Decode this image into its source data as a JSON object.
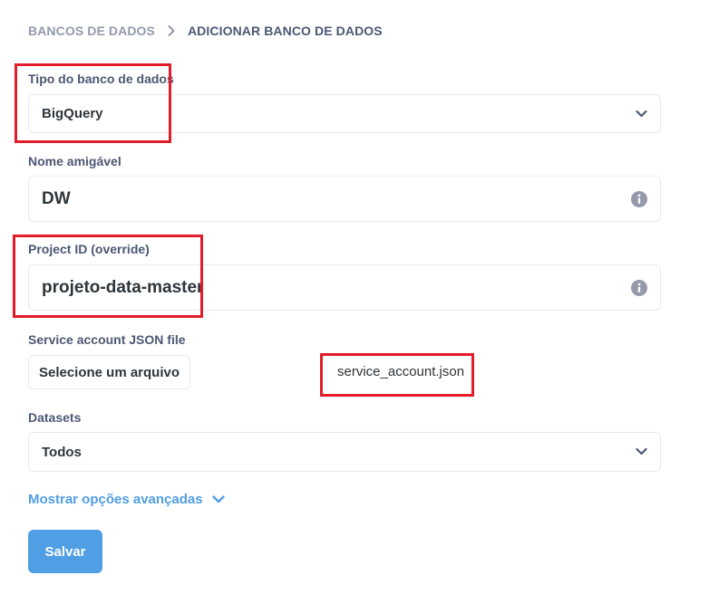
{
  "breadcrumb": {
    "parent": "BANCOS DE DADOS",
    "current": "ADICIONAR BANCO DE DADOS"
  },
  "form": {
    "db_type": {
      "label": "Tipo do banco de dados",
      "value": "BigQuery"
    },
    "display_name": {
      "label": "Nome amigável",
      "value": "DW"
    },
    "project_id": {
      "label": "Project ID (override)",
      "value": "projeto-data-master"
    },
    "service_account": {
      "label": "Service account JSON file",
      "button": "Selecione um arquivo",
      "filename": "service_account.json"
    },
    "datasets": {
      "label": "Datasets",
      "value": "Todos"
    }
  },
  "advanced_link": "Mostrar opções avançadas",
  "save_button": "Salvar",
  "colors": {
    "accent": "#509ee3",
    "annotation": "#e11d2a",
    "text": "#4c5773"
  },
  "icons": {
    "breadcrumb_sep": "chevron-right-icon",
    "select": "chevron-down-icon",
    "info": "info-icon"
  }
}
